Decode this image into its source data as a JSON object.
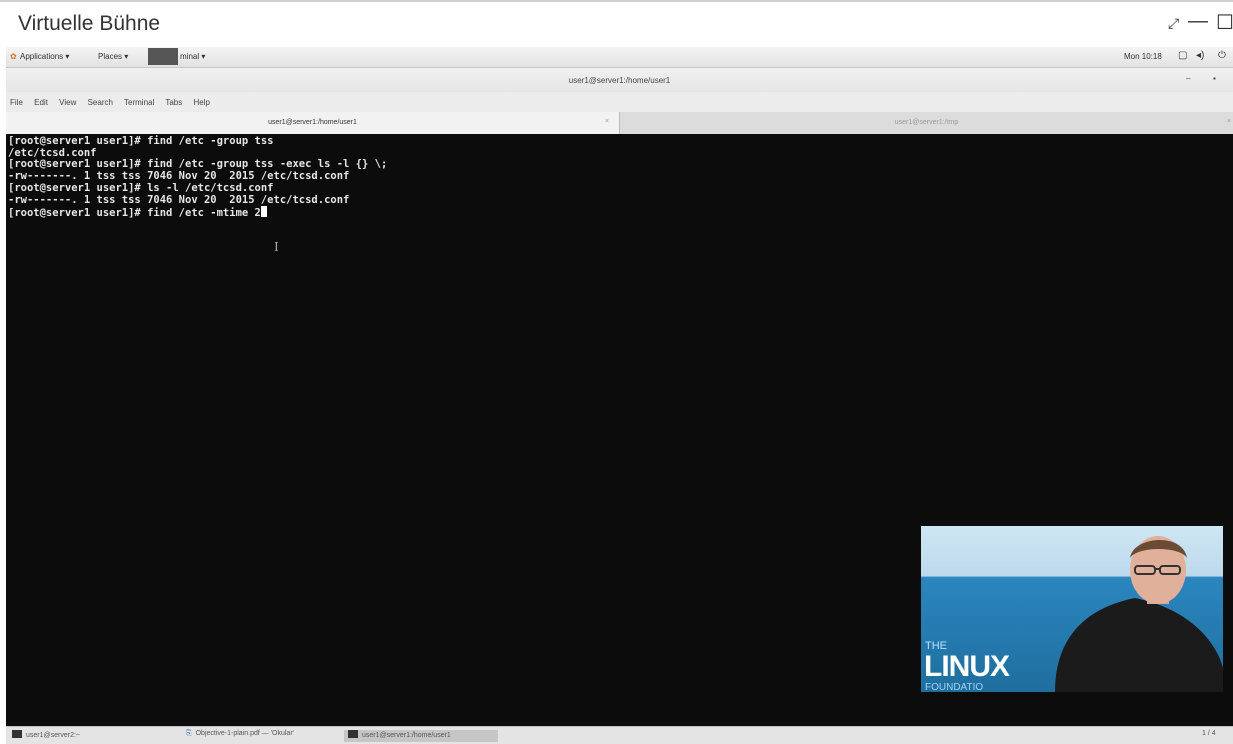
{
  "window": {
    "title": "Virtuelle Bühne",
    "fullscreen_icon": "fullscreen-icon",
    "minimize_icon": "minimize-icon",
    "maximize_icon": "maximize-icon"
  },
  "gnome_bar": {
    "applications": "Applications ▾",
    "places": "Places ▾",
    "terminal": "minal ▾",
    "clock": "Mon 10:18"
  },
  "terminal_window": {
    "title": "user1@server1:/home/user1",
    "menu": [
      "File",
      "Edit",
      "View",
      "Search",
      "Terminal",
      "Tabs",
      "Help"
    ],
    "tabs": [
      {
        "label": "user1@server1:/home/user1",
        "active": true
      },
      {
        "label": "user1@server1:/tmp",
        "active": false
      }
    ],
    "lines": [
      "[root@server1 user1]# find /etc -group tss",
      "/etc/tcsd.conf",
      "[root@server1 user1]# find /etc -group tss -exec ls -l {} \\;",
      "-rw-------. 1 tss tss 7046 Nov 20  2015 /etc/tcsd.conf",
      "[root@server1 user1]# ls -l /etc/tcsd.conf",
      "-rw-------. 1 tss tss 7046 Nov 20  2015 /etc/tcsd.conf",
      "[root@server1 user1]# find /etc -mtime 2"
    ]
  },
  "video": {
    "the": "THE",
    "linux": "LINUX",
    "foundation": "FOUNDATIO"
  },
  "taskbar": {
    "items": [
      "user1@server2:~",
      "Objective-1-plain.pdf — 'Okular'",
      "user1@server1:/home/user1"
    ],
    "workspace": "1 / 4"
  },
  "colors": {
    "terminal_bg": "#0c0c0c",
    "terminal_fg": "#e6e6e6",
    "video_blue": "#1f6e9e"
  }
}
